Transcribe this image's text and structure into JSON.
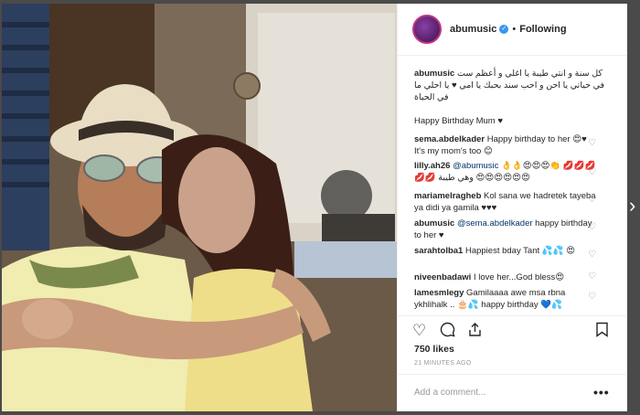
{
  "post": {
    "username": "abumusic",
    "separator": "•",
    "following_label": "Following",
    "caption_user": "abumusic",
    "caption_arabic": "كل سنة و انتي طيبة يا اغلي و أعظم ست في حياتي يا احن و احب سند بحبك يا امي ♥ يا احلي ما في الحياة",
    "caption_english": "Happy Birthday Mum ♥",
    "likes": "750 likes",
    "time": "21 MINUTES AGO",
    "add_comment_placeholder": "Add a comment...",
    "more": "•••",
    "next_arrow": "›"
  },
  "comments": [
    {
      "user": "sema.abdelkader",
      "mention": "",
      "text": "Happy birthday to her 😍♥ It's my mom's too 😊"
    },
    {
      "user": "lilly.ah26",
      "mention": "@abumusic",
      "text": "👌👌😍😍😍👏 💋💋💋💋💋 وهي طيبة 😍😍😍😍😍😍"
    },
    {
      "user": "mariamelragheb",
      "mention": "",
      "text": "Kol sana we hadretek tayeba ya didi ya gamila ♥♥♥"
    },
    {
      "user": "abumusic",
      "mention": "@sema.abdelkader",
      "text": "happy birthday to her ♥"
    },
    {
      "user": "sarahtolba1",
      "mention": "",
      "text": "Happiest bday Tant 💦💦 😍"
    },
    {
      "user": "niveenbadawi",
      "mention": "",
      "text": "I love her...God bless😍"
    },
    {
      "user": "lamesmlegy",
      "mention": "",
      "text": "Gamilaaaa awe msa rbna ykhlihalk .. 🎂💦 happy birthday 💙💦"
    }
  ],
  "icons": {
    "like": "heart-icon",
    "comment": "comment-icon",
    "share": "share-icon",
    "save": "bookmark-icon"
  },
  "colors": {
    "link": "#003569",
    "verified": "#3897f0",
    "text": "#262626",
    "muted": "#999999"
  }
}
